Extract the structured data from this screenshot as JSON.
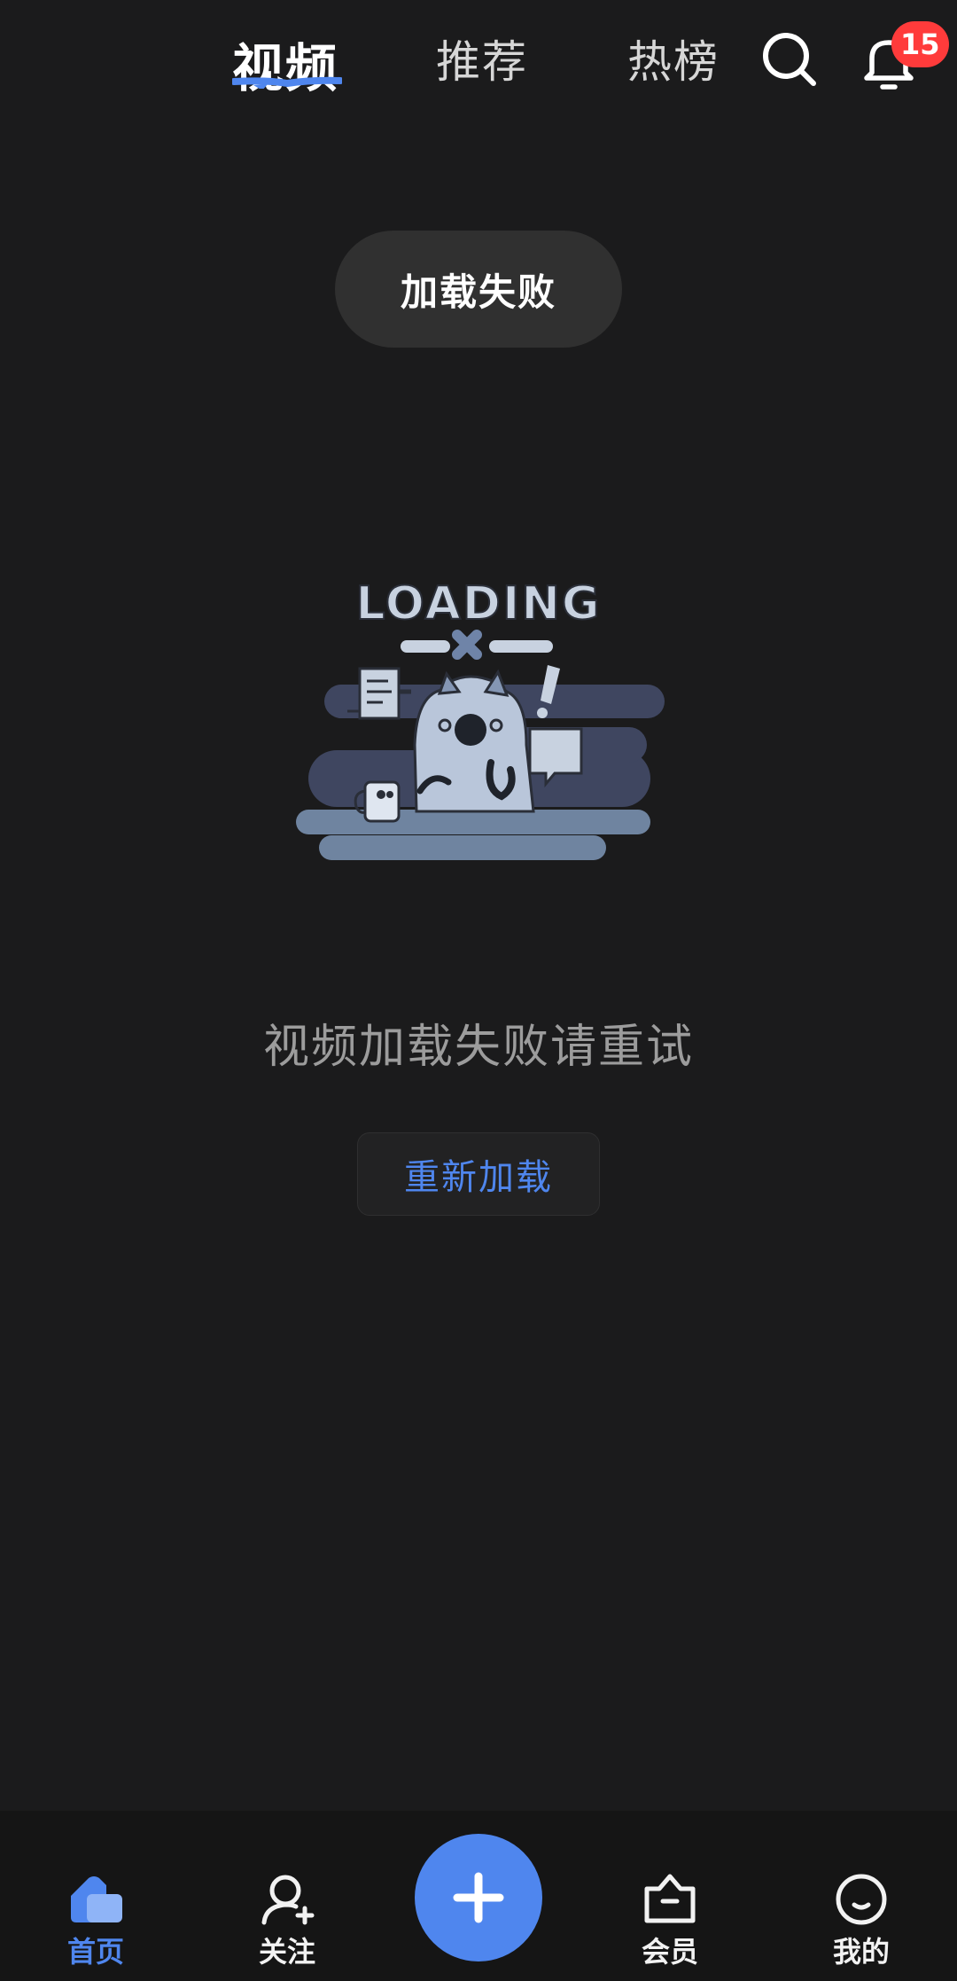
{
  "header": {
    "tabs": [
      {
        "label": "视频",
        "active": true
      },
      {
        "label": "推荐",
        "active": false
      },
      {
        "label": "热榜",
        "active": false
      }
    ],
    "search_icon": "search-icon",
    "bell_icon": "bell-icon",
    "notification_count": "15"
  },
  "toast": {
    "text": "加载失败"
  },
  "illustration": {
    "text": "LOADING"
  },
  "error": {
    "message": "视频加载失败请重试",
    "retry_label": "重新加载"
  },
  "bottom_nav": {
    "items": [
      {
        "label": "首页",
        "icon": "home-icon",
        "active": true
      },
      {
        "label": "关注",
        "icon": "follow-icon",
        "active": false
      },
      {
        "label": "会员",
        "icon": "vip-icon",
        "active": false
      },
      {
        "label": "我的",
        "icon": "profile-icon",
        "active": false
      }
    ],
    "create_icon": "plus-icon"
  },
  "colors": {
    "background": "#1b1b1c",
    "accent": "#4f86ee",
    "badge": "#ff3b3b",
    "toast": "#303030"
  }
}
